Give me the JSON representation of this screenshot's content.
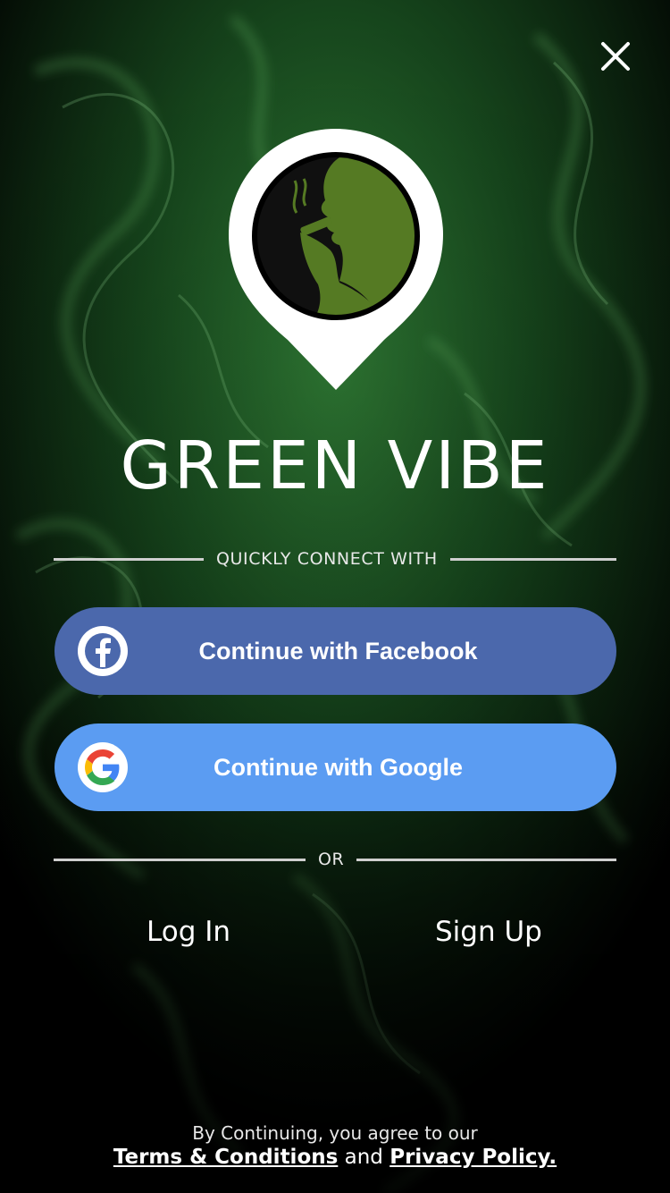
{
  "brand": {
    "name": "GREEN VIBE"
  },
  "colors": {
    "facebook": "#4b68ac",
    "google": "#5b9cf2",
    "brand_green": "#4f7a1f"
  },
  "connect": {
    "divider_label": "QUICKLY CONNECT WITH",
    "facebook_label": "Continue with Facebook",
    "google_label": "Continue with Google"
  },
  "or_label": "OR",
  "auth": {
    "login_label": "Log In",
    "signup_label": "Sign Up"
  },
  "legal": {
    "prefix": "By Continuing, you agree to our",
    "terms": "Terms & Conditions",
    "and": "and",
    "privacy": "Privacy Policy."
  },
  "icons": {
    "close": "close-icon",
    "facebook": "facebook-icon",
    "google": "google-icon",
    "logo": "smoker-silhouette-logo"
  }
}
